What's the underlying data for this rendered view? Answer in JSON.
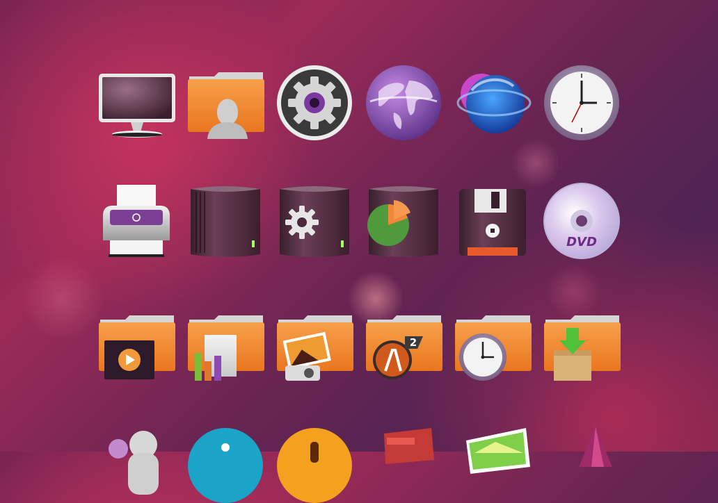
{
  "rows": [
    {
      "icons": [
        {
          "name": "monitor-icon"
        },
        {
          "name": "user-home-folder-icon"
        },
        {
          "name": "system-settings-icon"
        },
        {
          "name": "web-browser-globe-icon"
        },
        {
          "name": "network-sphere-icon"
        },
        {
          "name": "clock-icon"
        }
      ]
    },
    {
      "icons": [
        {
          "name": "printer-icon"
        },
        {
          "name": "hard-drive-icon"
        },
        {
          "name": "system-drive-icon"
        },
        {
          "name": "disk-usage-icon"
        },
        {
          "name": "floppy-disk-icon"
        },
        {
          "name": "dvd-disc-icon"
        }
      ]
    },
    {
      "icons": [
        {
          "name": "videos-folder-icon"
        },
        {
          "name": "documents-folder-icon"
        },
        {
          "name": "pictures-folder-icon"
        },
        {
          "name": "games-folder-icon"
        },
        {
          "name": "clock-folder-icon"
        },
        {
          "name": "downloads-folder-icon"
        }
      ]
    },
    {
      "icons": [
        {
          "name": "users-icon"
        },
        {
          "name": "info-icon"
        },
        {
          "name": "warning-icon"
        },
        {
          "name": "archive-box-icon"
        },
        {
          "name": "image-viewer-icon"
        },
        {
          "name": "graphics-app-icon"
        }
      ]
    }
  ],
  "icon_labels": {
    "disc_text": "DVD",
    "game_badge": "2"
  }
}
